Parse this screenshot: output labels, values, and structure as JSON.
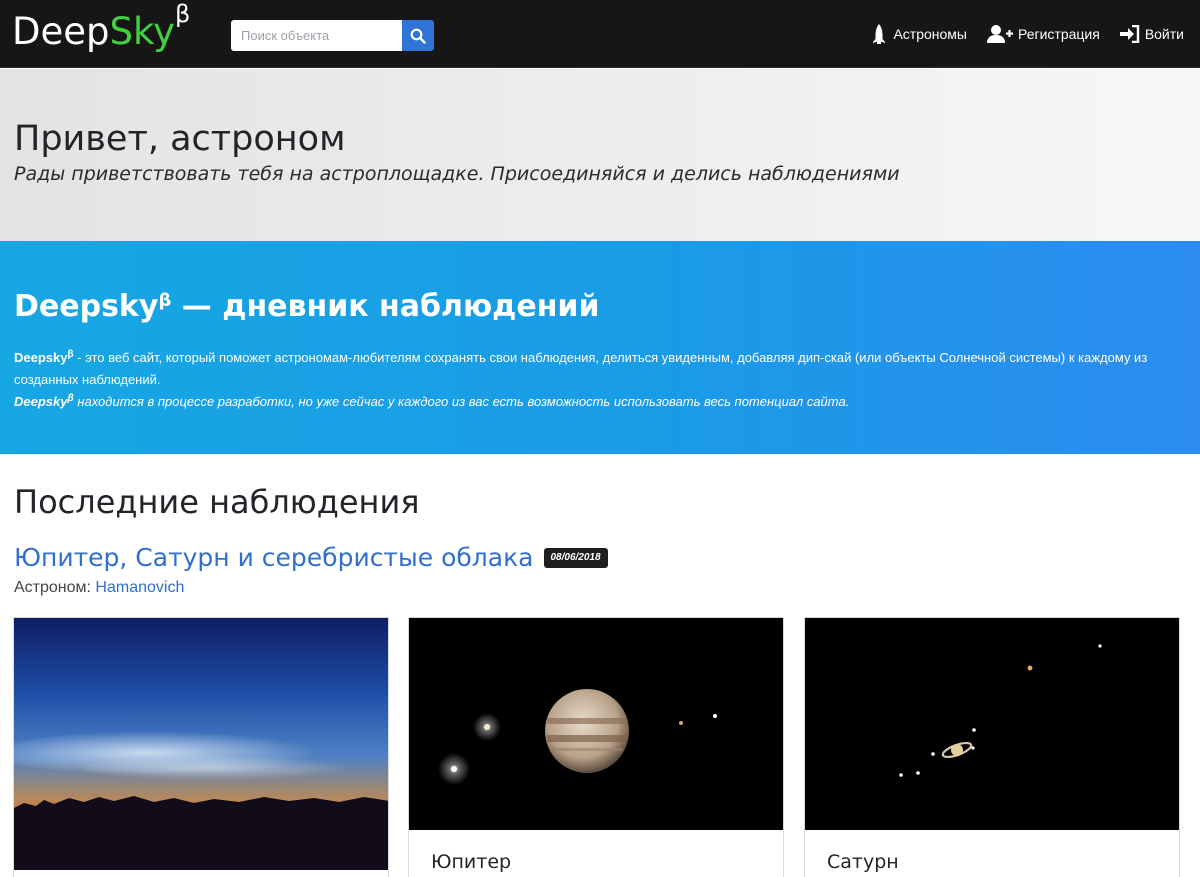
{
  "navbar": {
    "brand_main": "Deep",
    "brand_accent": "Sky",
    "brand_sup": "β",
    "search_placeholder": "Поиск объекта",
    "links": [
      {
        "label": "Астрономы",
        "icon": "shuttle-icon"
      },
      {
        "label": "Регистрация",
        "icon": "user-plus-icon"
      },
      {
        "label": "Войти",
        "icon": "sign-in-icon"
      }
    ]
  },
  "hero": {
    "title": "Привет, астроном",
    "subtitle": "Рады приветствовать тебя на астроплощадке. Присоединяйся и делись наблюдениями"
  },
  "banner": {
    "title_main": "Deepsky",
    "title_sup": "β",
    "title_rest": " — дневник наблюдений",
    "desc_brand": "Deepsky",
    "desc_brand_sup": "β",
    "desc_text": " - это веб сайт, который поможет астрономам-любителям сохранять свои наблюдения, делиться увиденным, добавляя дип-скай (или объекты Солнечной системы) к каждому из созданных наблюдений.",
    "desc2_brand": "Deepsky",
    "desc2_brand_sup": "β",
    "desc2_text": " находится в процессе разработки, но уже сейчас у каждого из вас есть возможность использовать весь потенциал сайта."
  },
  "latest": {
    "title": "Последние наблюдения",
    "observation": {
      "title": "Юпитер, Сатурн и серебристые облака",
      "date": "08/06/2018",
      "author_label": "Астроном: ",
      "author_name": "Hamanovich"
    },
    "cards": [
      {
        "title": ""
      },
      {
        "title": "Юпитер"
      },
      {
        "title": "Сатурн"
      }
    ]
  },
  "colors": {
    "navbar_bg": "#161616",
    "brand_accent": "#3fd13f",
    "search_button": "#2f74d6",
    "banner": "#1a9be6",
    "link": "#2f6fd0"
  }
}
